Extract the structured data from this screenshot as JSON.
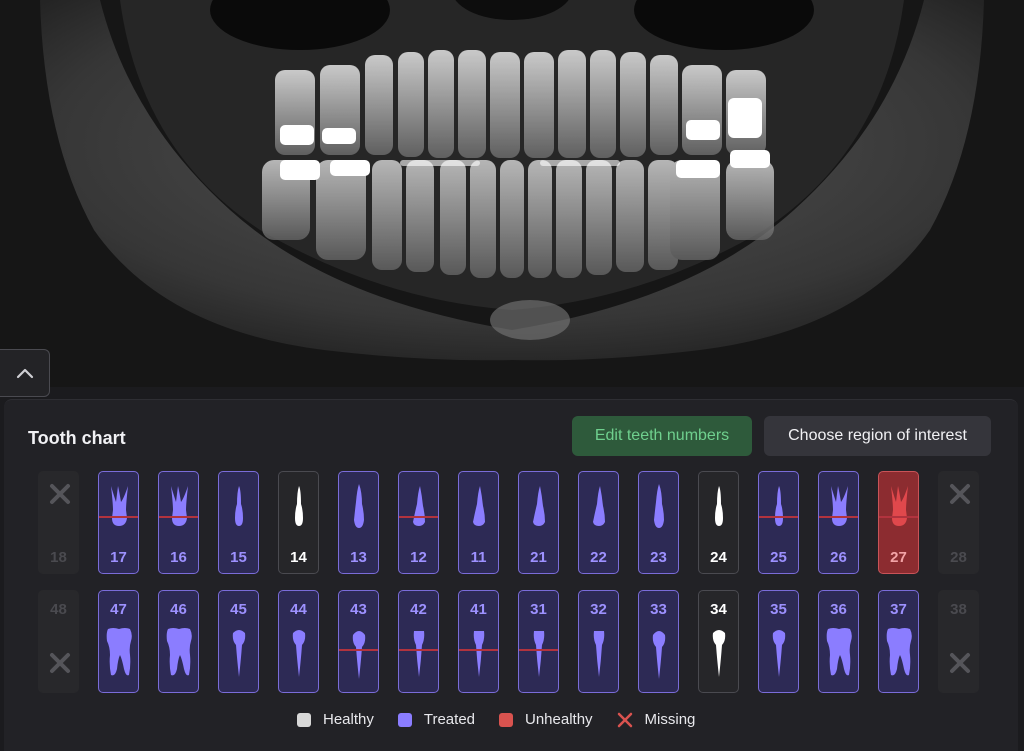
{
  "panel": {
    "title": "Tooth chart",
    "edit_button": "Edit teeth numbers",
    "roi_button": "Choose region of interest"
  },
  "colors": {
    "treated": "#8b7dff",
    "healthy": "#d8d8d8",
    "unhealthy": "#d9534f",
    "missing": "#d9534f",
    "edit_button_text": "#6fd08e"
  },
  "upper_teeth": [
    {
      "num": "18",
      "status": "missing",
      "shape": "molar",
      "line": false
    },
    {
      "num": "17",
      "status": "treated",
      "shape": "molar",
      "line": true
    },
    {
      "num": "16",
      "status": "treated",
      "shape": "molar",
      "line": true
    },
    {
      "num": "15",
      "status": "treated",
      "shape": "premolar",
      "line": false
    },
    {
      "num": "14",
      "status": "healthy",
      "shape": "premolar",
      "line": false
    },
    {
      "num": "13",
      "status": "treated",
      "shape": "canine",
      "line": false
    },
    {
      "num": "12",
      "status": "treated",
      "shape": "incisor",
      "line": true
    },
    {
      "num": "11",
      "status": "treated",
      "shape": "incisor",
      "line": false
    },
    {
      "num": "21",
      "status": "treated",
      "shape": "incisor",
      "line": false
    },
    {
      "num": "22",
      "status": "treated",
      "shape": "incisor",
      "line": false
    },
    {
      "num": "23",
      "status": "treated",
      "shape": "canine",
      "line": false
    },
    {
      "num": "24",
      "status": "healthy",
      "shape": "premolar",
      "line": false
    },
    {
      "num": "25",
      "status": "treated",
      "shape": "premolar",
      "line": true
    },
    {
      "num": "26",
      "status": "treated",
      "shape": "molar",
      "line": true
    },
    {
      "num": "27",
      "status": "unhealthy",
      "shape": "molar",
      "line": true
    },
    {
      "num": "28",
      "status": "missing",
      "shape": "molar",
      "line": false
    }
  ],
  "lower_teeth": [
    {
      "num": "48",
      "status": "missing",
      "shape": "molar",
      "line": false
    },
    {
      "num": "47",
      "status": "treated",
      "shape": "molar",
      "line": false
    },
    {
      "num": "46",
      "status": "treated",
      "shape": "molar",
      "line": false
    },
    {
      "num": "45",
      "status": "treated",
      "shape": "premolar",
      "line": false
    },
    {
      "num": "44",
      "status": "treated",
      "shape": "premolar",
      "line": false
    },
    {
      "num": "43",
      "status": "treated",
      "shape": "canine",
      "line": true
    },
    {
      "num": "42",
      "status": "treated",
      "shape": "incisor",
      "line": true
    },
    {
      "num": "41",
      "status": "treated",
      "shape": "incisor",
      "line": true
    },
    {
      "num": "31",
      "status": "treated",
      "shape": "incisor",
      "line": true
    },
    {
      "num": "32",
      "status": "treated",
      "shape": "incisor",
      "line": false
    },
    {
      "num": "33",
      "status": "treated",
      "shape": "canine",
      "line": false
    },
    {
      "num": "34",
      "status": "healthy",
      "shape": "premolar",
      "line": false
    },
    {
      "num": "35",
      "status": "treated",
      "shape": "premolar",
      "line": false
    },
    {
      "num": "36",
      "status": "treated",
      "shape": "molar",
      "line": false
    },
    {
      "num": "37",
      "status": "treated",
      "shape": "molar",
      "line": false
    },
    {
      "num": "38",
      "status": "missing",
      "shape": "molar",
      "line": false
    }
  ],
  "legend": [
    {
      "label": "Healthy",
      "key": "healthy"
    },
    {
      "label": "Treated",
      "key": "treated"
    },
    {
      "label": "Unhealthy",
      "key": "unhealthy"
    },
    {
      "label": "Missing",
      "key": "missing"
    }
  ]
}
